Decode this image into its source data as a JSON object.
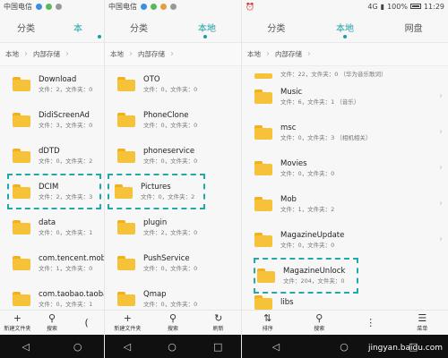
{
  "panel1": {
    "status": {
      "carrier": "中国电信"
    },
    "tabs": [
      "分类",
      "本"
    ],
    "breadcrumb": [
      "本地",
      "内部存储"
    ],
    "folders": [
      {
        "name": "Download",
        "meta": "文件：2，文件夹：0"
      },
      {
        "name": "DidiScreenAd",
        "meta": "文件：3，文件夹：0"
      },
      {
        "name": "dDTD",
        "meta": "文件：0，文件夹：2"
      },
      {
        "name": "DCIM",
        "meta": "文件：2，文件夹：3",
        "highlight": true
      },
      {
        "name": "data",
        "meta": "文件：0，文件夹：1"
      },
      {
        "name": "com.tencent.mobil",
        "meta": "文件：1，文件夹：0"
      },
      {
        "name": "com.taobao.taoba",
        "meta": "文件：0，文件夹：1"
      }
    ],
    "toolbar": [
      {
        "icon": "+",
        "label": "新建文件夹"
      },
      {
        "icon": "⚲",
        "label": "搜索"
      },
      {
        "icon": "(",
        "label": ""
      }
    ]
  },
  "panel2": {
    "status": {
      "carrier": "中国电信"
    },
    "tabs": [
      "分类",
      "本地"
    ],
    "breadcrumb": [
      "本地",
      "内部存储"
    ],
    "folders": [
      {
        "name": "OTO",
        "meta": "文件：0，文件夹：0"
      },
      {
        "name": "PhoneClone",
        "meta": "文件：0，文件夹：0"
      },
      {
        "name": "phoneservice",
        "meta": "文件：0，文件夹：0"
      },
      {
        "name": "Pictures",
        "meta": "文件：0，文件夹：2",
        "highlight": true
      },
      {
        "name": "plugin",
        "meta": "文件：2，文件夹：0"
      },
      {
        "name": "PushService",
        "meta": "文件：0，文件夹：0"
      },
      {
        "name": "Qmap",
        "meta": "文件：0，文件夹：0"
      }
    ],
    "toolbar": [
      {
        "icon": "+",
        "label": "新建文件夹"
      },
      {
        "icon": "⚲",
        "label": "搜索"
      },
      {
        "icon": "↻",
        "label": "刷新"
      }
    ]
  },
  "panel3": {
    "status": {
      "signal": "4G",
      "battery": "100%",
      "time": "11:29"
    },
    "tabs": [
      "分类",
      "本地",
      "网盘"
    ],
    "breadcrumb": [
      "本地",
      "内部存储"
    ],
    "partial_meta": "文件：22，文件夹：0  （华为音乐歌词）",
    "folders": [
      {
        "name": "Music",
        "meta": "文件：6，文件夹：1  （音乐）"
      },
      {
        "name": "msc",
        "meta": "文件：0，文件夹：3  （相机相关）"
      },
      {
        "name": "Movies",
        "meta": "文件：0，文件夹：0"
      },
      {
        "name": "Mob",
        "meta": "文件：1，文件夹：2"
      },
      {
        "name": "MagazineUpdate",
        "meta": "文件：0，文件夹：0"
      },
      {
        "name": "MagazineUnlock",
        "meta": "文件：204，文件夹：0",
        "highlight": true
      }
    ],
    "partial_name": "libs",
    "toolbar": [
      {
        "icon": "⇅",
        "label": "排序"
      },
      {
        "icon": "⚲",
        "label": "搜索"
      },
      {
        "icon": "⋮",
        "label": ""
      },
      {
        "icon": "☰",
        "label": "菜单"
      }
    ]
  },
  "watermark": "jingyan.baidu.com",
  "colors": {
    "accent": "#1a9ea8",
    "folder": "#f6c23a",
    "highlight": "#1fa9a9"
  }
}
